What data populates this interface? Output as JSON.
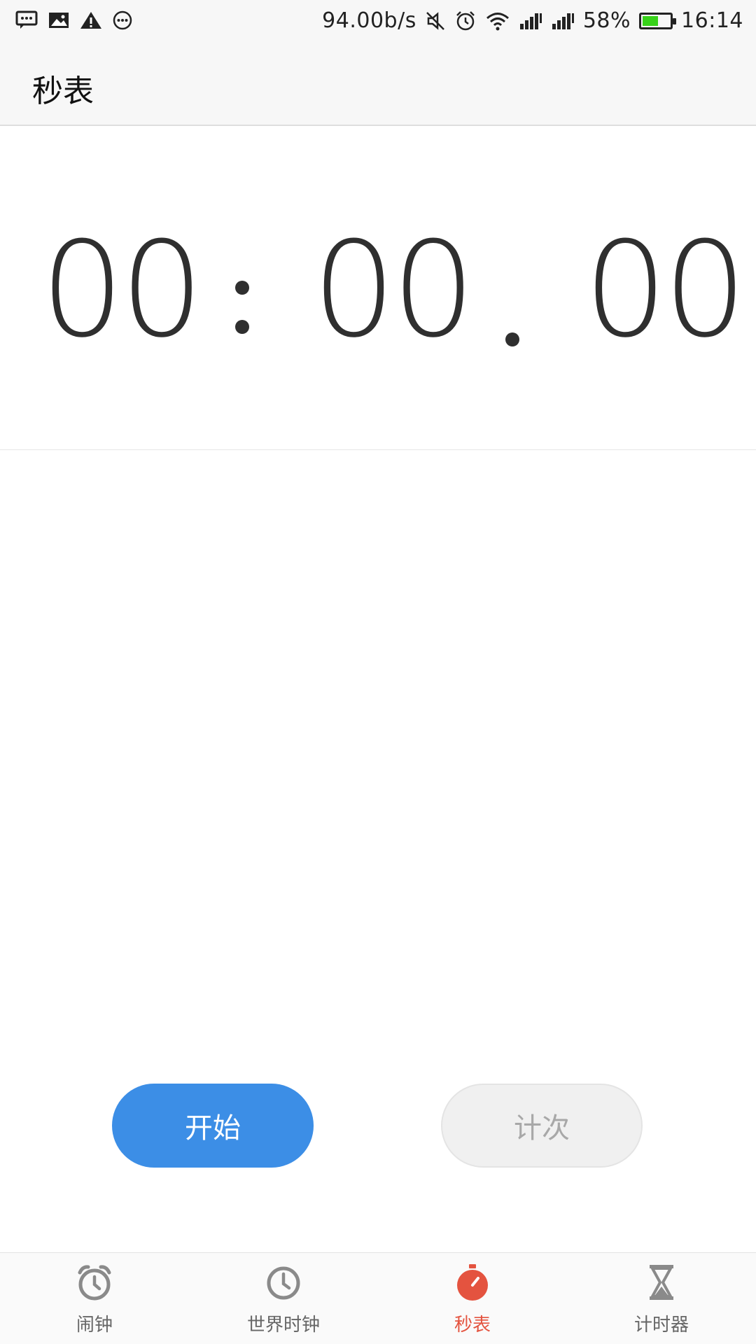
{
  "status_bar": {
    "net_speed": "94.00b/s",
    "battery_percent": "58%",
    "battery_level": 0.58,
    "time": "16:14",
    "icons": [
      "message-icon",
      "image-icon",
      "warning-icon",
      "more-icon",
      "mute-icon",
      "alarm-icon",
      "wifi-icon",
      "signal-icon",
      "signal-icon-2",
      "battery-icon"
    ]
  },
  "app_bar": {
    "title": "秒表"
  },
  "timer": {
    "minutes": "00",
    "seconds": "00",
    "hundredths": "00"
  },
  "buttons": {
    "start_label": "开始",
    "lap_label": "计次"
  },
  "colors": {
    "accent": "#3c8ee6",
    "active_tab": "#e4533f",
    "battery": "#37d219"
  },
  "bottom_nav": {
    "items": [
      {
        "label": "闹钟",
        "icon": "alarm-clock-icon",
        "active": false
      },
      {
        "label": "世界时钟",
        "icon": "clock-icon",
        "active": false
      },
      {
        "label": "秒表",
        "icon": "stopwatch-icon",
        "active": true
      },
      {
        "label": "计时器",
        "icon": "hourglass-icon",
        "active": false
      }
    ]
  }
}
